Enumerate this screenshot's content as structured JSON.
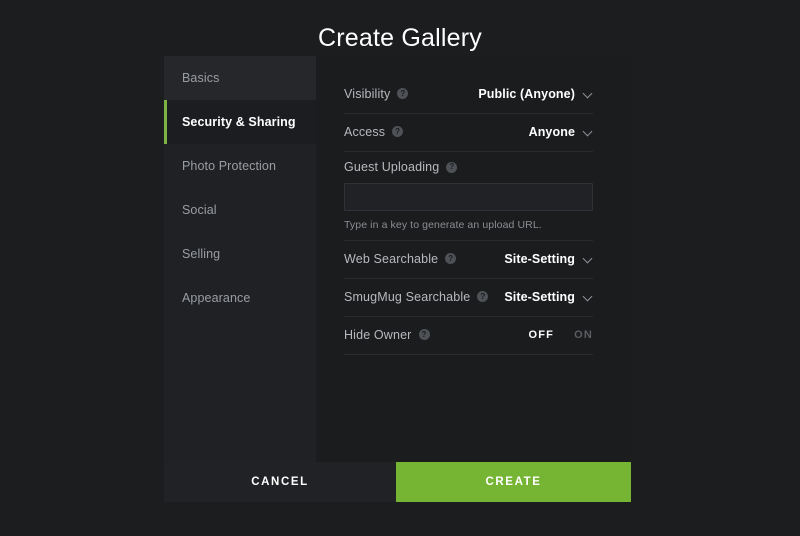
{
  "dialog": {
    "title": "Create Gallery"
  },
  "sidebar": {
    "items": [
      {
        "label": "Basics",
        "state": "hover"
      },
      {
        "label": "Security & Sharing",
        "state": "active"
      },
      {
        "label": "Photo Protection",
        "state": "normal"
      },
      {
        "label": "Social",
        "state": "normal"
      },
      {
        "label": "Selling",
        "state": "normal"
      },
      {
        "label": "Appearance",
        "state": "normal"
      }
    ]
  },
  "form": {
    "visibility": {
      "label": "Visibility",
      "value": "Public (Anyone)",
      "help": "?"
    },
    "access": {
      "label": "Access",
      "value": "Anyone",
      "help": "?"
    },
    "guest_uploading": {
      "label": "Guest Uploading",
      "help": "?",
      "value": "",
      "placeholder": "",
      "helper_text": "Type in a key to generate an upload URL."
    },
    "web_searchable": {
      "label": "Web Searchable",
      "value": "Site-Setting",
      "help": "?"
    },
    "smugmug_searchable": {
      "label": "SmugMug Searchable",
      "value": "Site-Setting",
      "help": "?"
    },
    "hide_owner": {
      "label": "Hide Owner",
      "help": "?",
      "off_label": "OFF",
      "on_label": "ON",
      "selected": "OFF"
    }
  },
  "footer": {
    "cancel_label": "CANCEL",
    "create_label": "CREATE"
  },
  "colors": {
    "accent_green": "#76b533",
    "active_bar_green": "#7cb342",
    "page_background": "#1c1d1f",
    "sidebar_background": "#1f2124",
    "dialog_background": "#1b1c1e"
  }
}
